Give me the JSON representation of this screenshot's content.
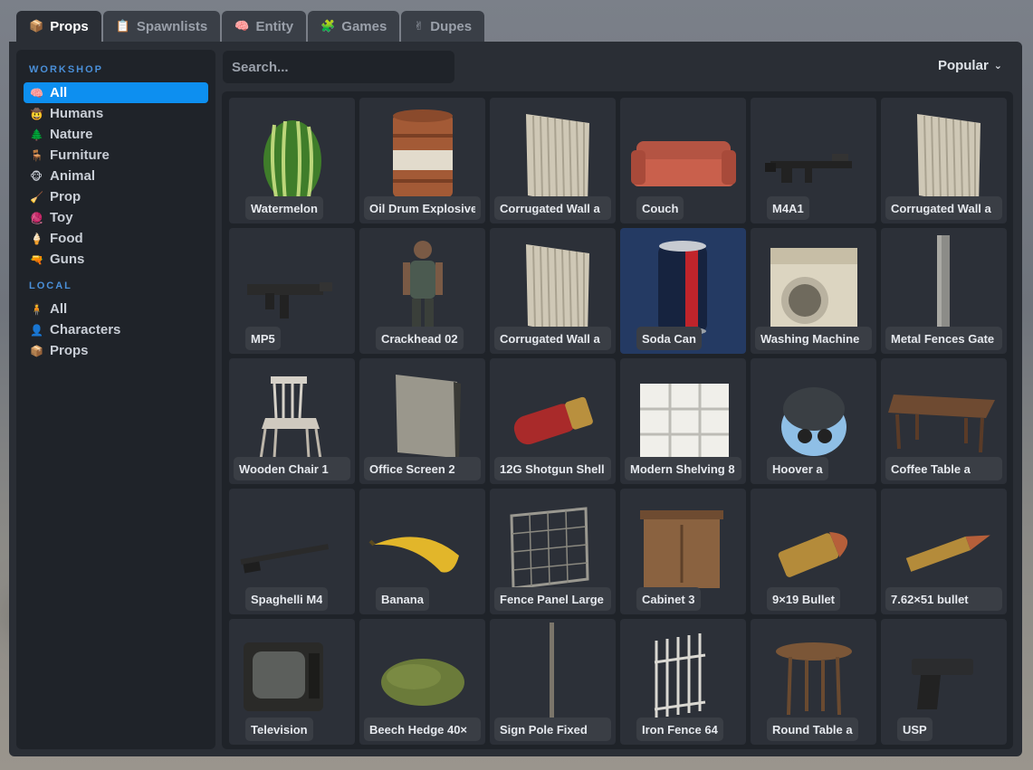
{
  "tabs": [
    {
      "label": "Props",
      "icon": "box-icon",
      "glyph": "📦",
      "active": true
    },
    {
      "label": "Spawnlists",
      "icon": "notepad-icon",
      "glyph": "📋",
      "active": false
    },
    {
      "label": "Entity",
      "icon": "brain-icon",
      "glyph": "🧠",
      "active": false
    },
    {
      "label": "Games",
      "icon": "puzzle-icon",
      "glyph": "🧩",
      "active": false
    },
    {
      "label": "Dupes",
      "icon": "victory-hand-icon",
      "glyph": "✌",
      "active": false
    }
  ],
  "sidebar": {
    "workshop_title": "WORKSHOP",
    "workshop_items": [
      {
        "label": "All",
        "icon": "brain-icon",
        "glyph": "🧠",
        "active": true
      },
      {
        "label": "Humans",
        "icon": "face-icon",
        "glyph": "🤠",
        "active": false
      },
      {
        "label": "Nature",
        "icon": "tree-icon",
        "glyph": "🌲",
        "active": false
      },
      {
        "label": "Furniture",
        "icon": "chair-icon",
        "glyph": "🪑",
        "active": false
      },
      {
        "label": "Animal",
        "icon": "monkey-icon",
        "glyph": "🐵",
        "active": false
      },
      {
        "label": "Prop",
        "icon": "broom-icon",
        "glyph": "🧹",
        "active": false
      },
      {
        "label": "Toy",
        "icon": "yarn-icon",
        "glyph": "🧶",
        "active": false
      },
      {
        "label": "Food",
        "icon": "icecream-icon",
        "glyph": "🍦",
        "active": false
      },
      {
        "label": "Guns",
        "icon": "water-gun-icon",
        "glyph": "🔫",
        "active": false
      }
    ],
    "local_title": "LOCAL",
    "local_items": [
      {
        "label": "All",
        "icon": "person-icon",
        "glyph": "🧍",
        "active": false
      },
      {
        "label": "Characters",
        "icon": "person-icon",
        "glyph": "👤",
        "active": false
      },
      {
        "label": "Props",
        "icon": "box-icon",
        "glyph": "📦",
        "active": false
      }
    ]
  },
  "search": {
    "placeholder": "Search...",
    "value": ""
  },
  "sort": {
    "label": "Popular"
  },
  "items": [
    {
      "label": "Watermelon",
      "kind": "watermelon"
    },
    {
      "label": "Oil Drum Explosive",
      "kind": "drum"
    },
    {
      "label": "Corrugated Wall a",
      "kind": "wall"
    },
    {
      "label": "Couch",
      "kind": "couch"
    },
    {
      "label": "M4A1",
      "kind": "rifle"
    },
    {
      "label": "Corrugated Wall a",
      "kind": "wall"
    },
    {
      "label": "MP5",
      "kind": "smg"
    },
    {
      "label": "Crackhead 02",
      "kind": "person"
    },
    {
      "label": "Corrugated Wall a",
      "kind": "wall"
    },
    {
      "label": "Soda Can",
      "kind": "can",
      "selected": true
    },
    {
      "label": "Washing Machine",
      "kind": "washer"
    },
    {
      "label": "Metal Fences Gate",
      "kind": "post"
    },
    {
      "label": "Wooden Chair 1",
      "kind": "chair"
    },
    {
      "label": "Office Screen 2",
      "kind": "screen"
    },
    {
      "label": "12G Shotgun Shell",
      "kind": "shell"
    },
    {
      "label": "Modern Shelving 8",
      "kind": "shelf"
    },
    {
      "label": "Hoover a",
      "kind": "hoover"
    },
    {
      "label": "Coffee Table a",
      "kind": "table"
    },
    {
      "label": "Spaghelli M4",
      "kind": "shotgun"
    },
    {
      "label": "Banana",
      "kind": "banana"
    },
    {
      "label": "Fence Panel Large",
      "kind": "fence"
    },
    {
      "label": "Cabinet 3",
      "kind": "cabinet"
    },
    {
      "label": "9×19 Bullet",
      "kind": "bullet"
    },
    {
      "label": "7.62×51 bullet",
      "kind": "rifle-bullet"
    },
    {
      "label": "Television",
      "kind": "tv"
    },
    {
      "label": "Beech Hedge 40×",
      "kind": "hedge"
    },
    {
      "label": "Sign Pole Fixed",
      "kind": "pole"
    },
    {
      "label": "Iron Fence 64",
      "kind": "ironfence"
    },
    {
      "label": "Round Table a",
      "kind": "roundtable"
    },
    {
      "label": "USP",
      "kind": "pistol"
    }
  ],
  "colors": {
    "accent": "#0d8ff0",
    "section": "#4a8fd8",
    "panel": "#1f2329",
    "window": "#2a2e35",
    "selected": "#243a63"
  }
}
